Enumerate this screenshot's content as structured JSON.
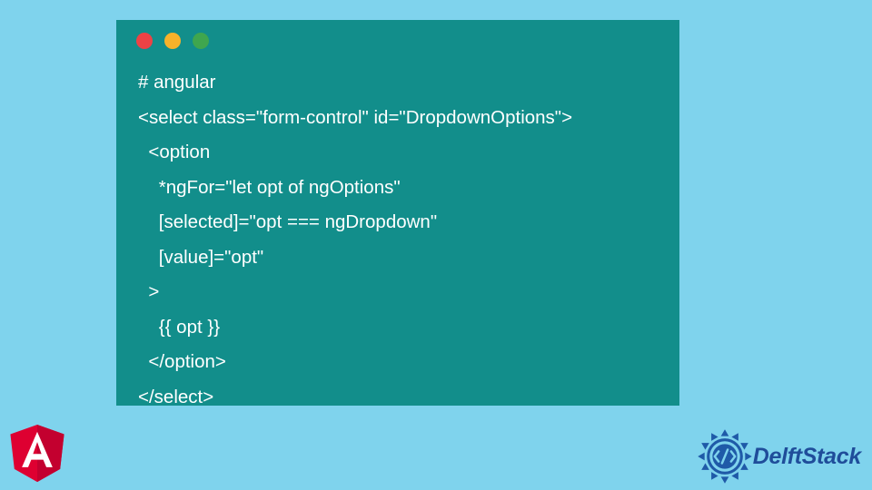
{
  "code": {
    "lines": [
      "# angular",
      "<select class=\"form-control\" id=\"DropdownOptions\">",
      "  <option",
      "    *ngFor=\"let opt of ngOptions\"",
      "    [selected]=\"opt === ngDropdown\"",
      "    [value]=\"opt\"",
      "  >",
      "    {{ opt }}",
      "  </option>",
      "</select>"
    ]
  },
  "branding": {
    "delftstack": "DelftStack",
    "angular_letter": "A"
  }
}
